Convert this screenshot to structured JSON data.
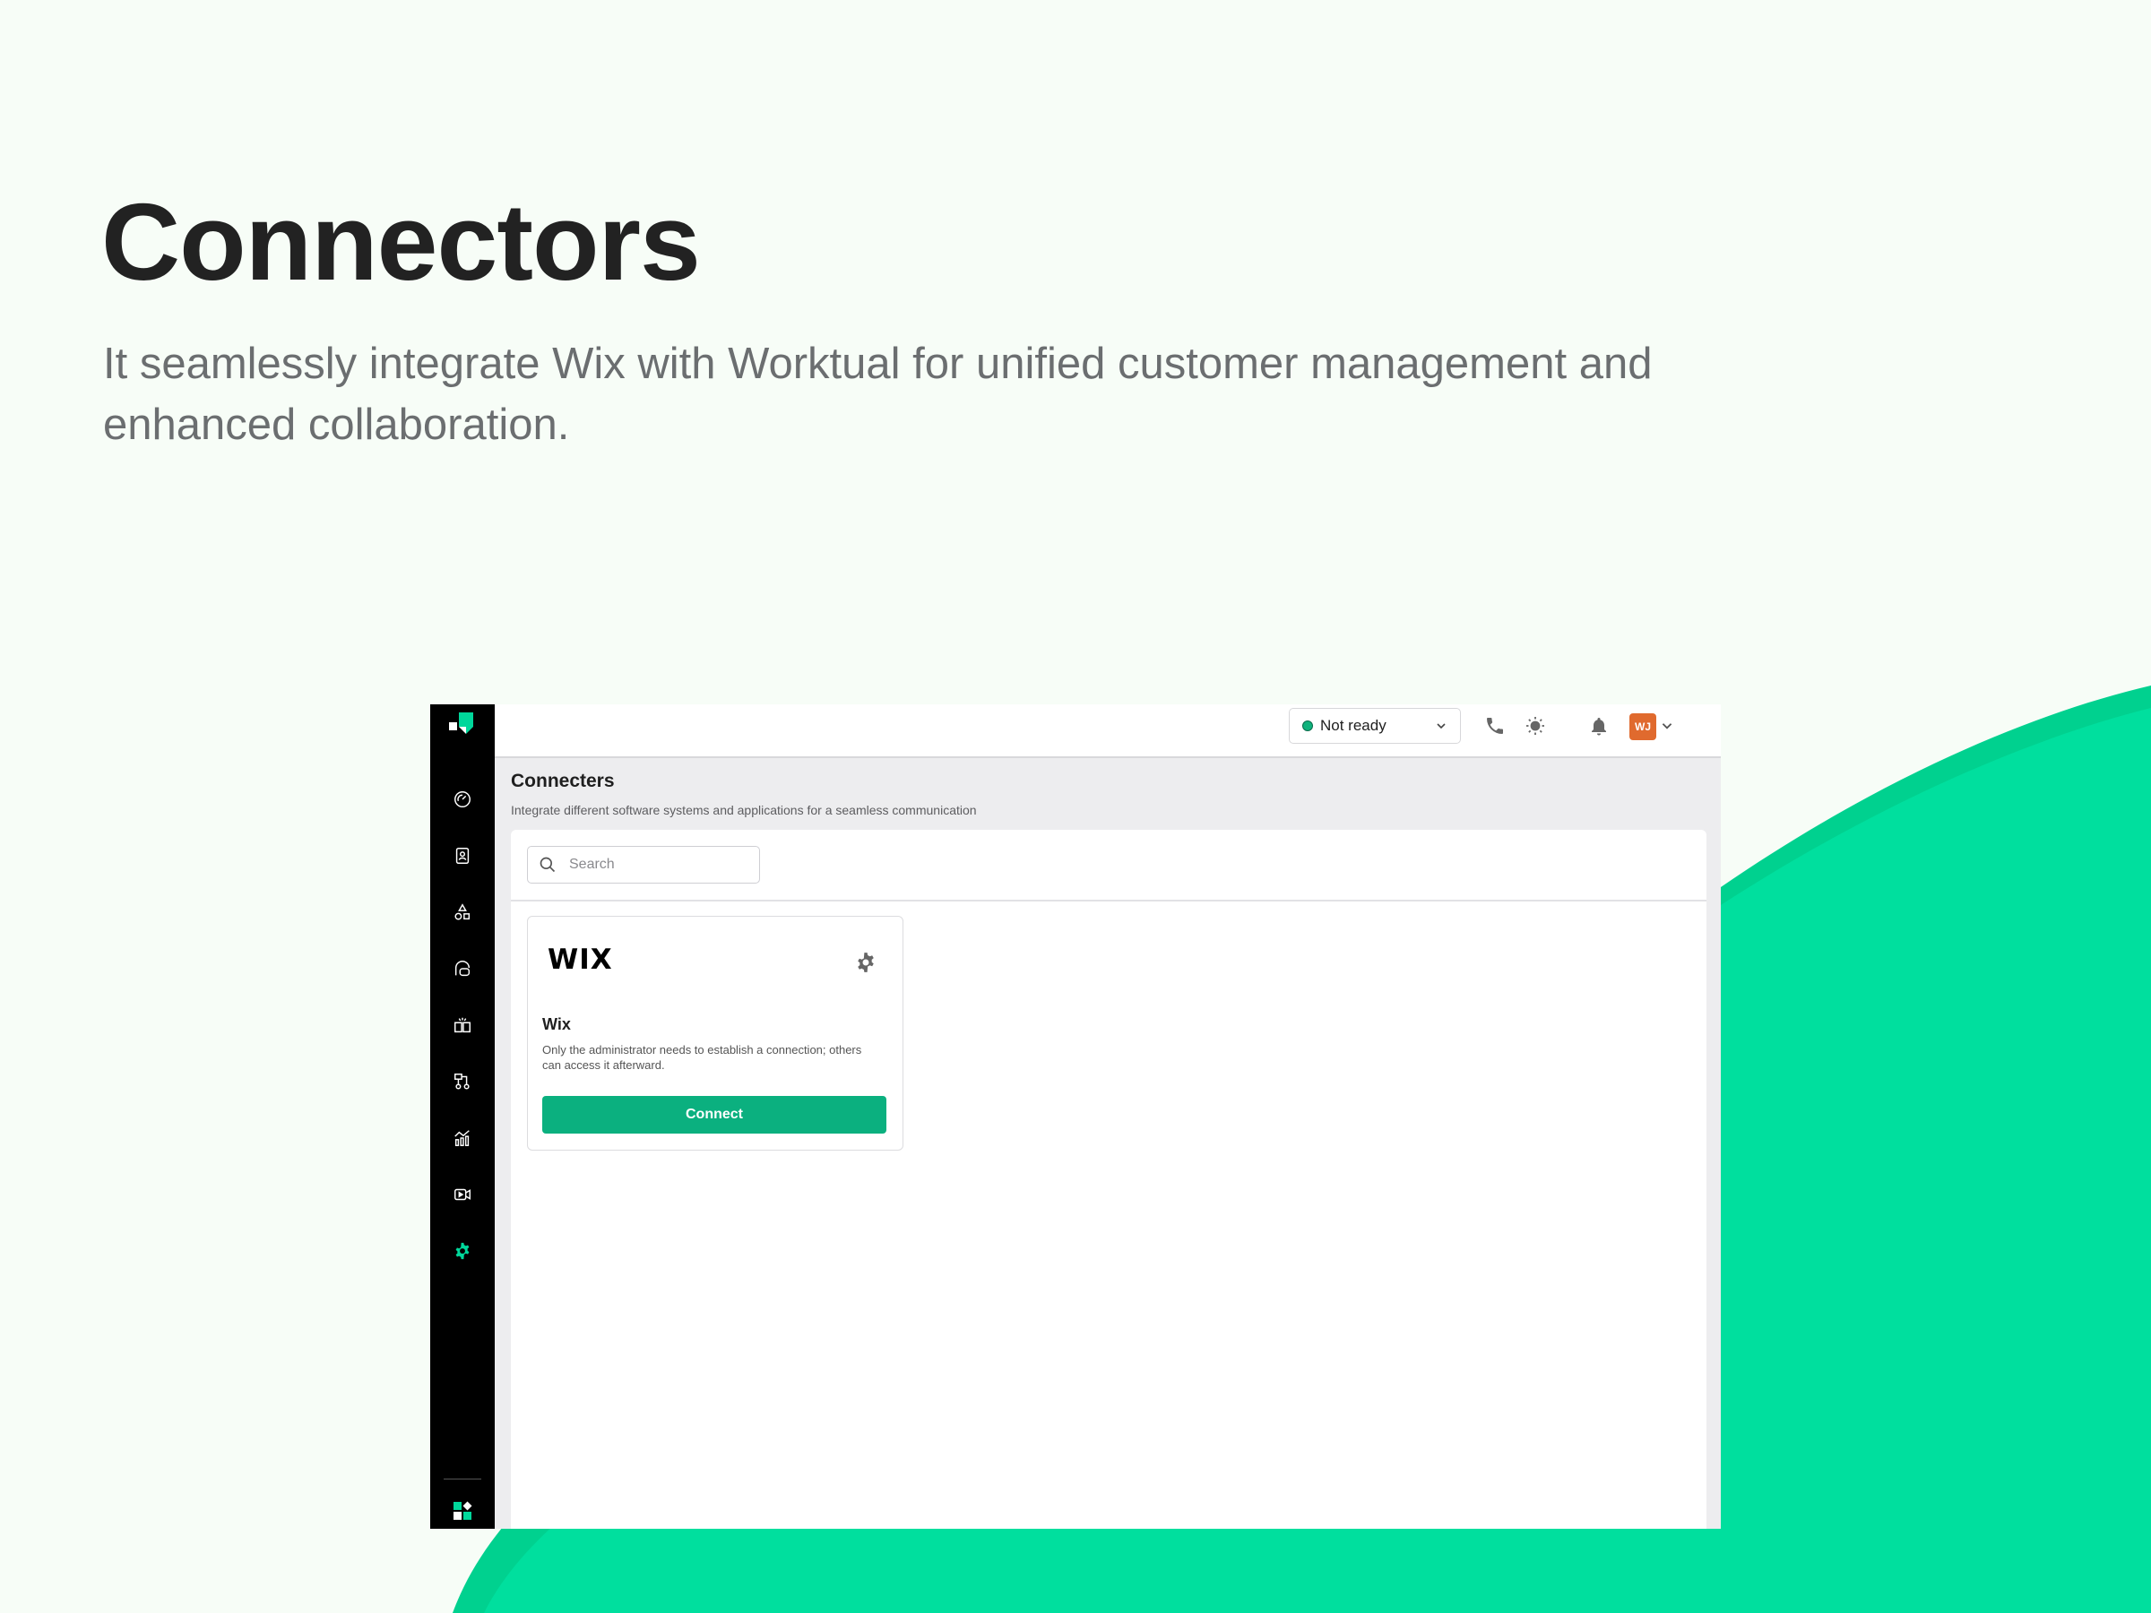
{
  "hero": {
    "title": "Connectors",
    "subtitle": "It seamlessly integrate Wix with Worktual for unified customer management and enhanced collaboration."
  },
  "colors": {
    "accent": "#00df9e",
    "button": "#0bb07f",
    "avatar": "#e06a2e",
    "sidebar": "#000000"
  },
  "sidebar": {
    "logo": "worktual-logo",
    "items": [
      {
        "icon": "dashboard-gauge-icon",
        "active": false
      },
      {
        "icon": "contacts-book-icon",
        "active": false
      },
      {
        "icon": "shapes-icon",
        "active": false
      },
      {
        "icon": "chat-bubble-icon",
        "active": false
      },
      {
        "icon": "knowledge-book-icon",
        "active": false
      },
      {
        "icon": "workflow-icon",
        "active": false
      },
      {
        "icon": "analytics-chart-icon",
        "active": false
      },
      {
        "icon": "video-camera-icon",
        "active": false
      },
      {
        "icon": "settings-gear-icon",
        "active": true
      }
    ],
    "bottom_icon": "apps-grid-icon"
  },
  "topbar": {
    "status": "Not ready",
    "avatar_initials": "WJ"
  },
  "page": {
    "heading": "Connecters",
    "description": "Integrate different software systems and applications for a seamless communication",
    "search": {
      "placeholder": "Search",
      "value": ""
    }
  },
  "connectors": [
    {
      "logo_text": "WIX",
      "name": "Wix",
      "description": "Only the administrator needs to establish a connection; others can access it afterward.",
      "button_label": "Connect"
    }
  ]
}
